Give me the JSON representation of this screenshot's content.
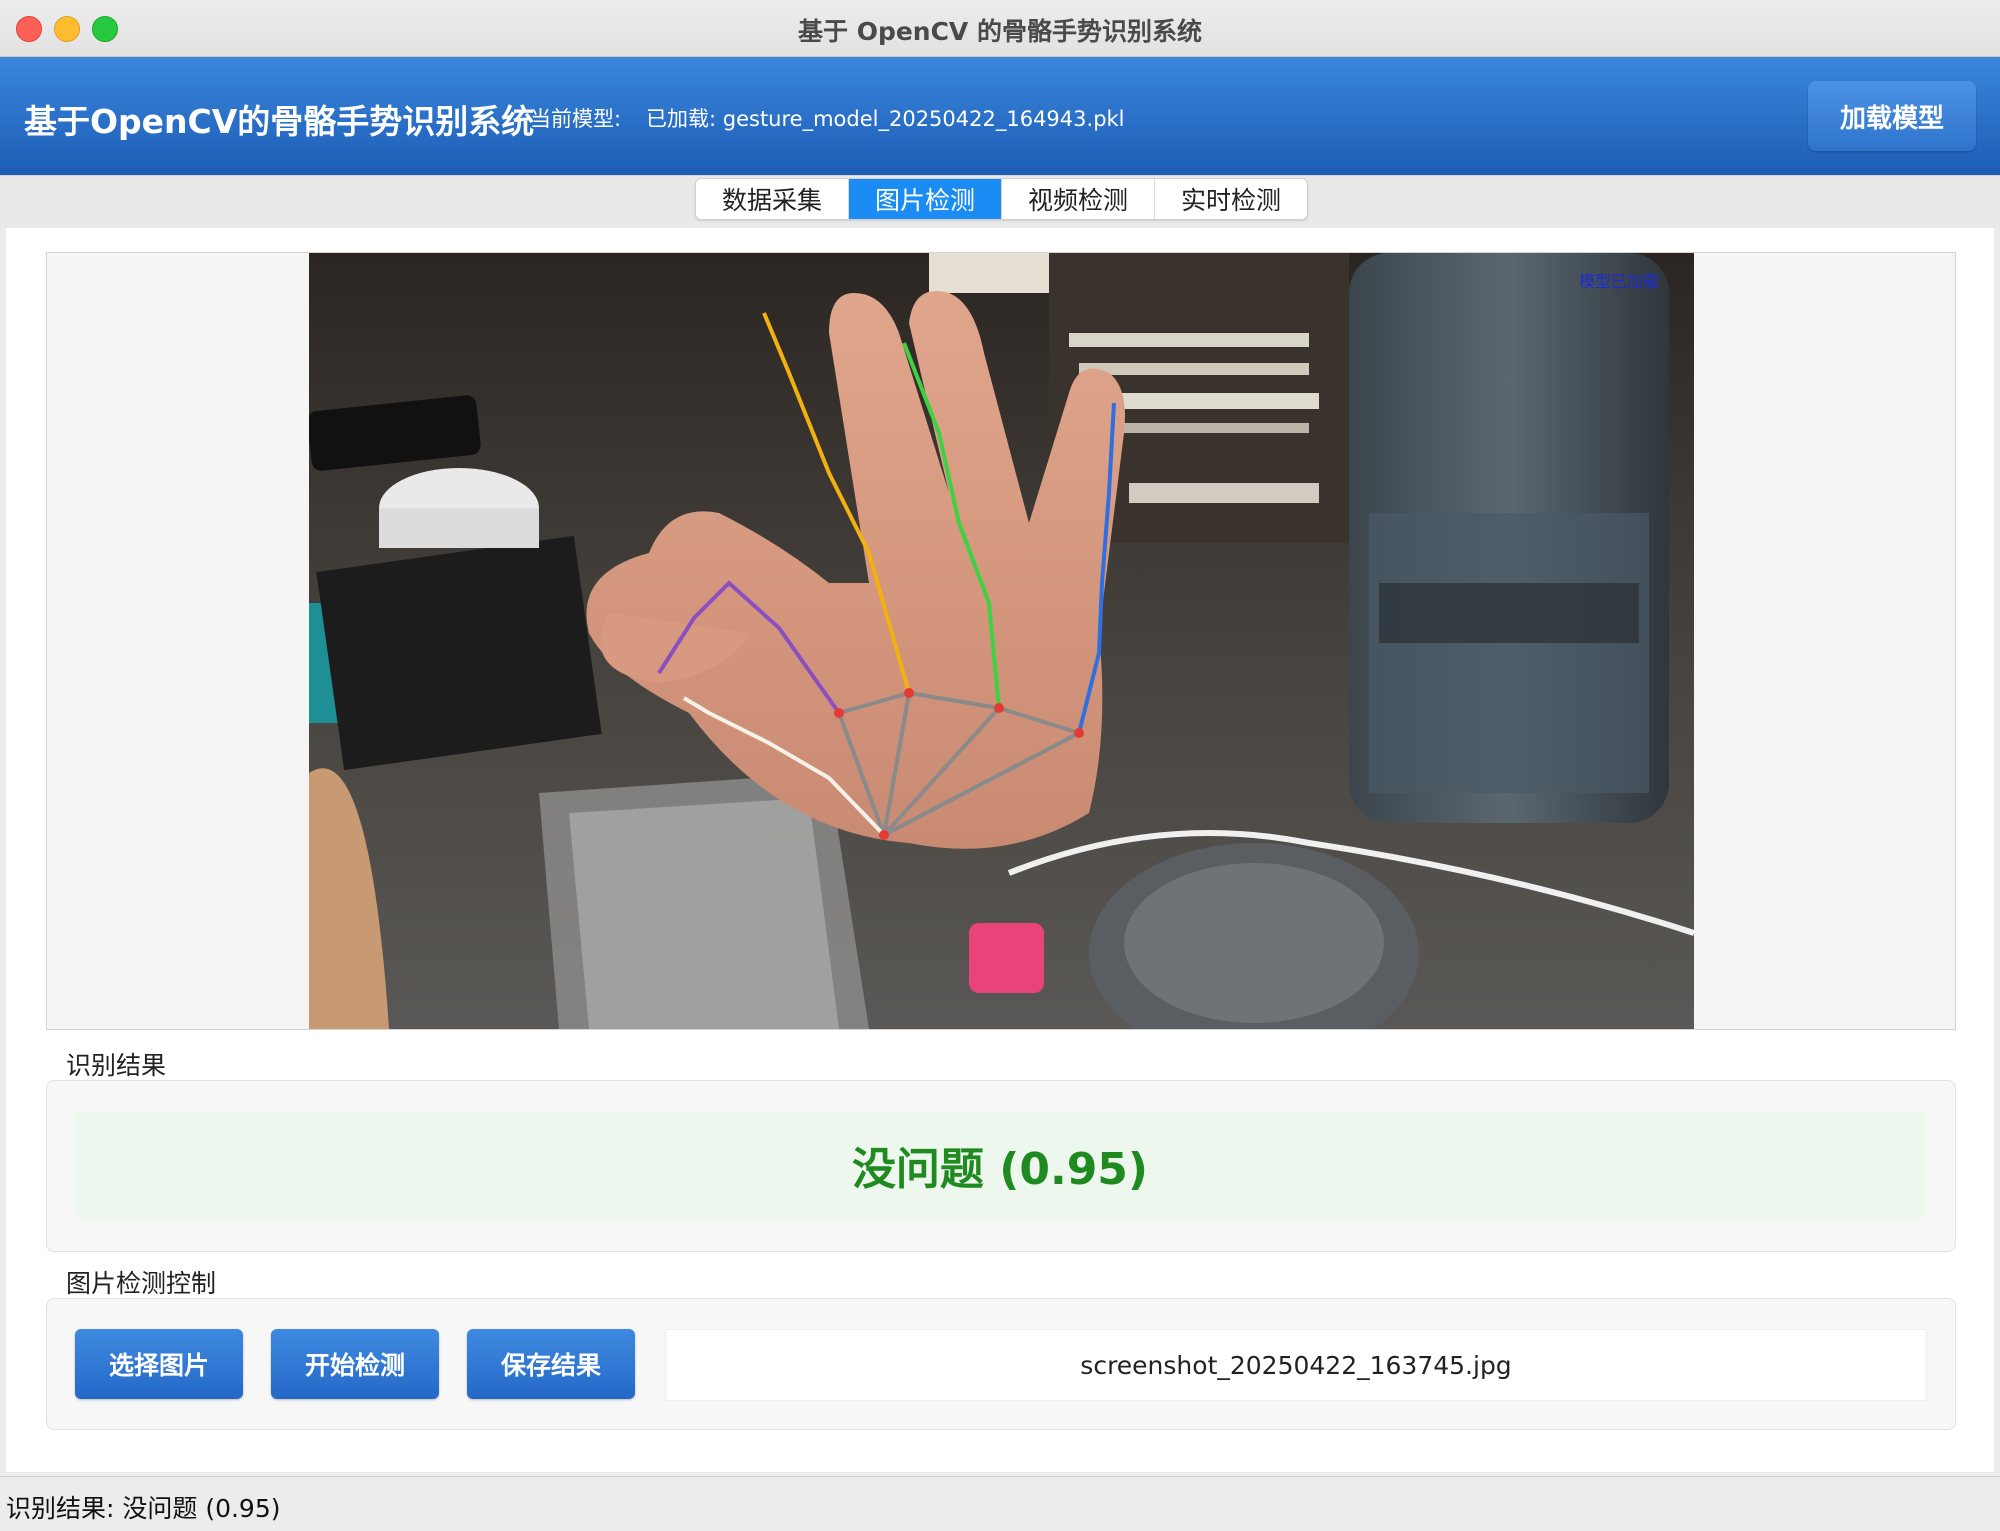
{
  "window": {
    "title": "基于 OpenCV 的骨骼手势识别系统"
  },
  "header": {
    "title": "基于OpenCV的骨骼手势识别系统",
    "model_label": "当前模型:",
    "model_value": "已加载: gesture_model_20250422_164943.pkl",
    "load_button": "加载模型"
  },
  "tabs": [
    {
      "label": "数据采集",
      "active": false
    },
    {
      "label": "图片检测",
      "active": true
    },
    {
      "label": "视频检测",
      "active": false
    },
    {
      "label": "实时检测",
      "active": false
    }
  ],
  "image": {
    "overlay_text": "模型已加载"
  },
  "result": {
    "section_label": "识别结果",
    "text": "没问题 (0.95)"
  },
  "controls": {
    "section_label": "图片检测控制",
    "select_button": "选择图片",
    "start_button": "开始检测",
    "save_button": "保存结果",
    "file_name": "screenshot_20250422_163745.jpg"
  },
  "statusbar": {
    "text": "识别结果: 没问题 (0.95)"
  }
}
